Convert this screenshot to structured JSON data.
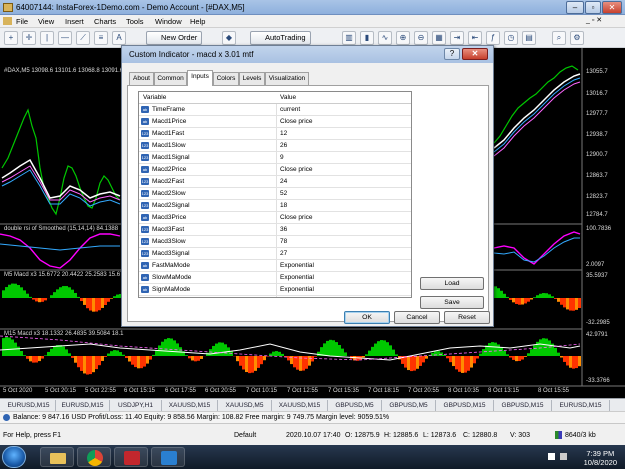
{
  "window": {
    "title": "64007144: InstaForex-1Demo.com - Demo Account - [#DAX,M5]",
    "controls": [
      "–",
      "▫",
      "✕"
    ]
  },
  "menu": [
    "File",
    "View",
    "Insert",
    "Charts",
    "Tools",
    "Window",
    "Help"
  ],
  "toolbar": {
    "new_order": "New Order",
    "autotrading": "AutoTrading"
  },
  "chart": {
    "main_label": "#DAX,M5  13098.6 13101.6 13068.8 13091.6",
    "pane2_label": "double rsi of Smoothed (15,14,14) 84.1388",
    "pane3_label": "M5 Macd x3 15.6772 20.4422 25.2583 15.67",
    "pane4_label": "M15 Macd x3 18.1332 26.4835 39.5084 18.1",
    "price_axis": [
      "13055.7",
      "13016.7",
      "12977.7",
      "12938.7",
      "12900.7",
      "12863.7",
      "12823.7",
      "12784.7",
      "100.7836",
      "2.0097",
      "35.5937",
      "-32.2985",
      "42.9791",
      "-33.3766"
    ],
    "time_axis": [
      "5 Oct 2020",
      "5 Oct 20:15",
      "5 Oct 22:55",
      "6 Oct 15:15",
      "6 Oct 17:55",
      "6 Oct 20:55",
      "7 Oct 10:15",
      "7 Oct 12:55",
      "7 Oct 15:35",
      "7 Oct 18:15",
      "7 Oct 20:55",
      "8 Oct 10:35",
      "8 Oct 13:15",
      "8 Oct 15:55"
    ]
  },
  "dialog": {
    "title": "Custom Indicator - macd x 3.01 mtf",
    "help": "?",
    "close": "✕",
    "tabs": [
      "About",
      "Common",
      "Inputs",
      "Colors",
      "Levels",
      "Visualization"
    ],
    "active_tab": "Inputs",
    "columns": [
      "Variable",
      "Value"
    ],
    "inputs": [
      {
        "icon": "ab",
        "name": "TimeFrame",
        "value": "current"
      },
      {
        "icon": "ab",
        "name": "Macd1Price",
        "value": "Close price"
      },
      {
        "icon": "123",
        "name": "Macd1Fast",
        "value": "12"
      },
      {
        "icon": "123",
        "name": "Macd1Slow",
        "value": "26"
      },
      {
        "icon": "123",
        "name": "Macd1Signal",
        "value": "9"
      },
      {
        "icon": "ab",
        "name": "Macd2Price",
        "value": "Close price"
      },
      {
        "icon": "123",
        "name": "Macd2Fast",
        "value": "24"
      },
      {
        "icon": "123",
        "name": "Macd2Slow",
        "value": "52"
      },
      {
        "icon": "123",
        "name": "Macd2Signal",
        "value": "18"
      },
      {
        "icon": "ab",
        "name": "Macd3Price",
        "value": "Close price"
      },
      {
        "icon": "123",
        "name": "Macd3Fast",
        "value": "36"
      },
      {
        "icon": "123",
        "name": "Macd3Slow",
        "value": "78"
      },
      {
        "icon": "123",
        "name": "Macd3Signal",
        "value": "27"
      },
      {
        "icon": "ab",
        "name": "FastMaMode",
        "value": "Exponential"
      },
      {
        "icon": "ab",
        "name": "SlowMaMode",
        "value": "Exponential"
      },
      {
        "icon": "ab",
        "name": "SignMaMode",
        "value": "Exponential"
      }
    ],
    "load_label": "Load",
    "save_label": "Save",
    "ok_label": "OK",
    "cancel_label": "Cancel",
    "reset_label": "Reset"
  },
  "symbol_tabs": [
    "EURUSD,M15",
    "EURUSD,M15",
    "USDJPY,H1",
    "XAUUSD,M15",
    "XAUUSD,M5",
    "XAUUSD,M15",
    "GBPUSD,M5",
    "GBPUSD,M5",
    "GBPUSD,M15",
    "GBPUSD,M15",
    "EURUSD,M15"
  ],
  "terminal": "Balance: 9 847.16 USD  Profit/Loss: 11.40  Equity: 9 858.56  Margin: 108.82  Free margin: 9 749.75  Margin level: 9059.51%",
  "status": {
    "help": "For Help, press F1",
    "default": "Default",
    "time": "2020.10.07 17:40",
    "open": "O: 12875.9",
    "high": "H: 12885.6",
    "low": "L: 12873.6",
    "close": "C: 12880.8",
    "volume": "V: 303",
    "traffic": "8640/3 kb"
  },
  "clock": {
    "time": "7:39 PM",
    "date": "10/8/2020"
  },
  "colors": {
    "chart_bg": "#000000",
    "bull": "#00c800",
    "bear": "#ff3300",
    "signal": "#ffffff",
    "rsi": "#ff00ff"
  }
}
